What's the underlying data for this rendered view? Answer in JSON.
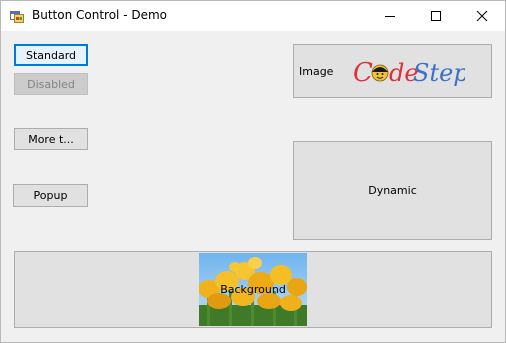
{
  "window": {
    "title": "Button Control - Demo"
  },
  "buttons": {
    "standard": "Standard",
    "disabled": "Disabled",
    "more": "More t...",
    "popup": "Popup",
    "image_label": "Image",
    "dynamic": "Dynamic",
    "background": "Background"
  },
  "logo": {
    "text_code": "Code",
    "text_steps": "Steps",
    "code_color": "#e0303a",
    "steps_color": "#3b6fc9"
  },
  "colors": {
    "focus_border": "#0078d7",
    "button_face": "#e1e1e1",
    "client_bg": "#f0f0f0"
  }
}
